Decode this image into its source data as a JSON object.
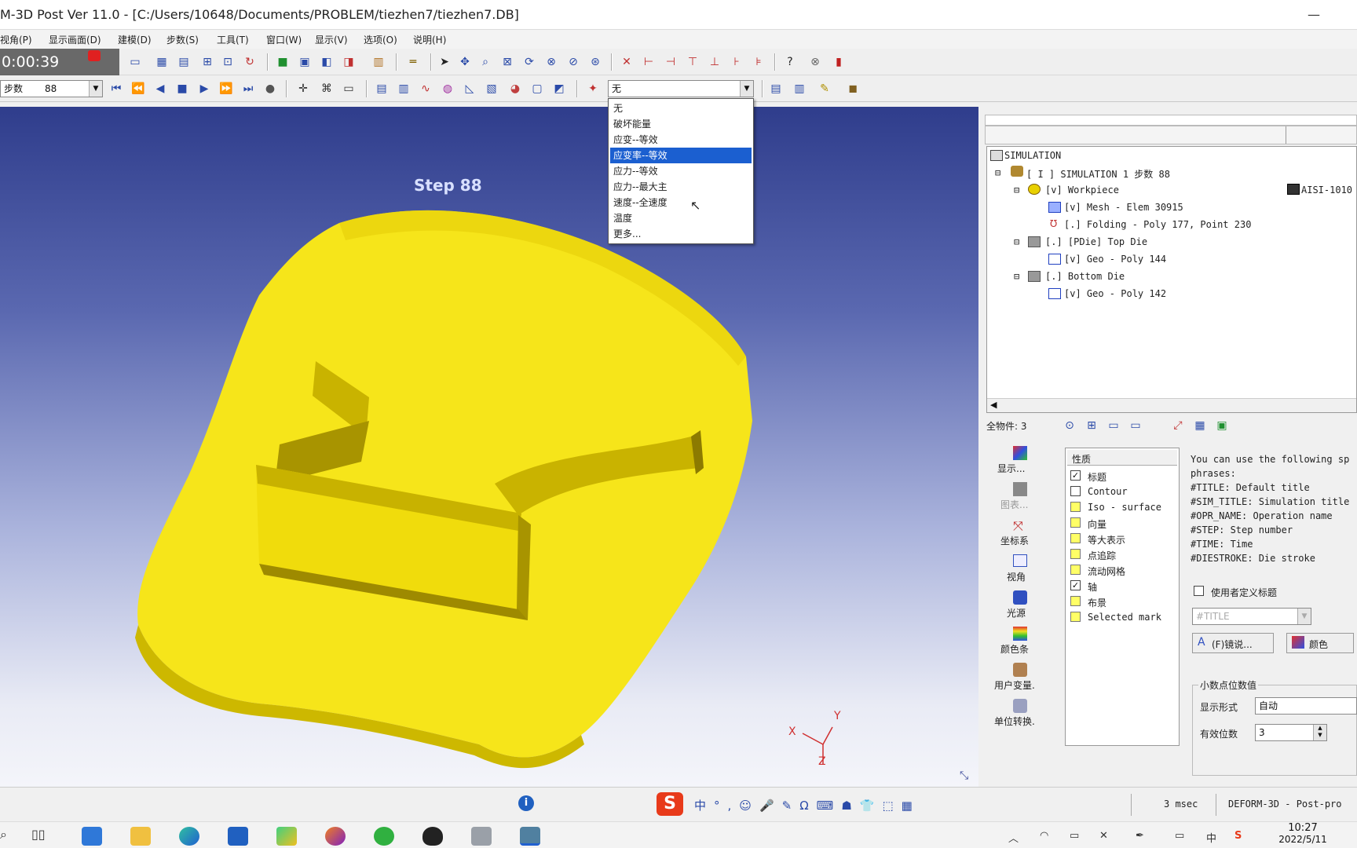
{
  "window": {
    "title": "M-3D Post Ver 11.0 - [C:/Users/10648/Documents/PROBLEM/tiezhen7/tiezhen7.DB]",
    "minimize_glyph": "—"
  },
  "menu": {
    "items": [
      "视角(P)",
      "显示画面(D)",
      "建模(D)",
      "步数(S)",
      "工具(T)",
      "窗口(W)",
      "显示(V)",
      "选项(O)",
      "说明(H)"
    ]
  },
  "recorder": {
    "time": "0:00:39"
  },
  "toolbar": {
    "step_label": "步数",
    "step_value": "88",
    "variable_value": "无"
  },
  "viewport": {
    "step_caption": "Step  88",
    "axis_x": "X",
    "axis_y": "Y",
    "axis_z": "Z",
    "part_color": "#f6e51a",
    "background_color": "#3a4899"
  },
  "dropdown": {
    "items": [
      "无",
      "破坏能量",
      "应变--等效",
      "应变率--等效",
      "应力--等效",
      "应力--最大主",
      "速度--全速度",
      "温度",
      "更多..."
    ],
    "selected_index": 3
  },
  "tree": {
    "root": "SIMULATION",
    "rows": [
      {
        "text": "[ I ]  SIMULATION 1  步数 88"
      },
      {
        "text": "[v] Workpiece"
      },
      {
        "text": "[v] Mesh - Elem 30915"
      },
      {
        "text": "[.] Folding - Poly 177, Point 230"
      },
      {
        "text": "[.] [PDie] Top Die"
      },
      {
        "text": "[v] Geo - Poly 144"
      },
      {
        "text": "[.] Bottom Die"
      },
      {
        "text": "[v] Geo - Poly 142"
      }
    ],
    "material": "AISI-1010"
  },
  "objects": {
    "count_label": "全物件: 3"
  },
  "side_icons": [
    "显示...",
    "图表...",
    "坐标系",
    "视角",
    "光源",
    "颜色条",
    "用户变量.",
    "单位转换."
  ],
  "property": {
    "header": "性质",
    "items": [
      {
        "label": "标题",
        "checked": true
      },
      {
        "label": "Contour",
        "checked": false
      },
      {
        "label": "Iso - surface",
        "checked": false
      },
      {
        "label": "向量",
        "checked": false
      },
      {
        "label": "等大表示",
        "checked": false
      },
      {
        "label": "点追踪",
        "checked": false
      },
      {
        "label": "流动网格",
        "checked": false
      },
      {
        "label": "轴",
        "checked": true
      },
      {
        "label": "布景",
        "checked": false
      },
      {
        "label": "Selected mark",
        "checked": false
      }
    ]
  },
  "help": {
    "lines": [
      "You can use the following sp",
      "phrases:",
      "#TITLE: Default title",
      "#SIM_TITLE: Simulation title",
      "#OPR_NAME: Operation name",
      "#STEP: Step number",
      "#TIME: Time",
      "#DIESTROKE: Die stroke"
    ],
    "custom_title_label": "使用者定义标题",
    "title_placeholder": "#TITLE",
    "font_btn": "(F)镜说...",
    "color_btn": "颜色",
    "decimal_group": "小数点位数值",
    "display_form_label": "显示形式",
    "display_form_value": "自动",
    "digits_label": "有效位数",
    "digits_value": "3"
  },
  "status": {
    "time": "3 msec",
    "app": "DEFORM-3D  -  Post-pro",
    "ime": [
      "中",
      "°,",
      "☺",
      "🎤",
      "✎",
      "Ω",
      "⌨",
      "☗",
      "👕",
      "⬚",
      "▦"
    ]
  },
  "taskbar": {
    "clock_time": "10:27",
    "clock_date": "2022/5/11"
  }
}
